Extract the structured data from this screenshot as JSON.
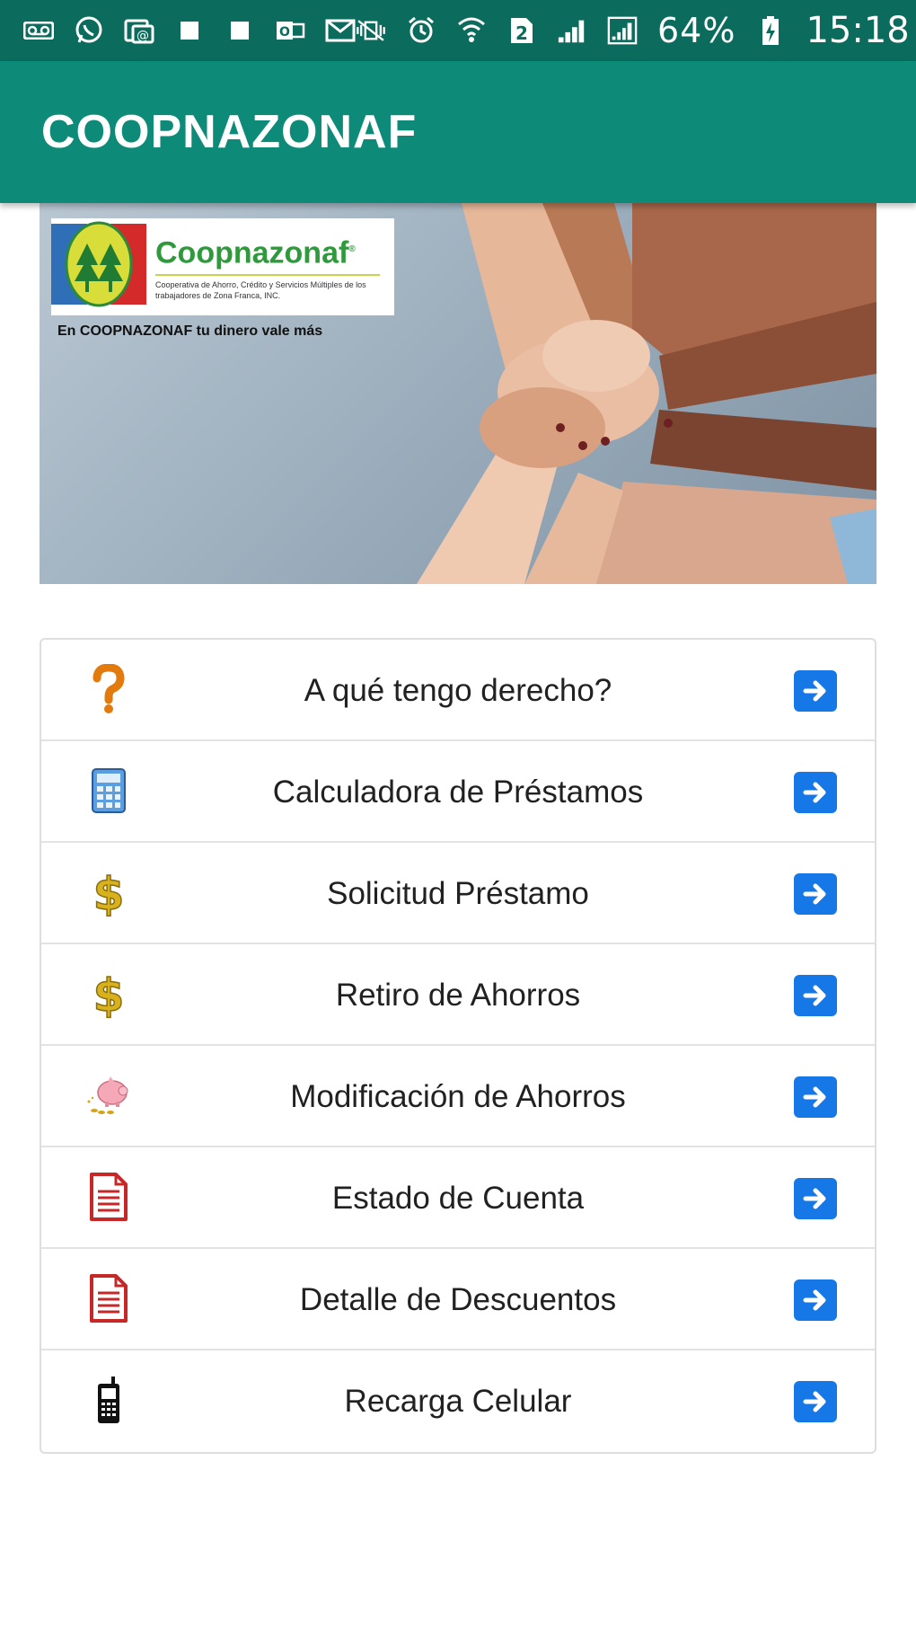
{
  "status_bar": {
    "icons_left": [
      "voicemail-icon",
      "whatsapp-icon",
      "email-app-icon",
      "square-notification-icon",
      "square-notification-icon",
      "outlook-icon",
      "mail-icon"
    ],
    "icons_right": [
      "vibrate-icon",
      "alarm-icon",
      "wifi-icon",
      "sim2-icon",
      "signal-icon",
      "signal-icon"
    ],
    "battery": "64%",
    "time": "15:18"
  },
  "app_bar": {
    "title": "COOPNAZONAF"
  },
  "banner": {
    "logo_name": "Coopnazonaf",
    "logo_mark": "®",
    "logo_subtitle": "Cooperativa de Ahorro, Crédito y Servicios Múltiples de los trabajadores de Zona Franca, INC.",
    "slogan": "En COOPNAZONAF tu dinero vale más"
  },
  "menu": {
    "items": [
      {
        "label": "A qué tengo derecho?",
        "icon": "question-mark-icon"
      },
      {
        "label": "Calculadora de Préstamos",
        "icon": "calculator-icon"
      },
      {
        "label": "Solicitud Préstamo",
        "icon": "dollar-sign-icon"
      },
      {
        "label": "Retiro de Ahorros",
        "icon": "dollar-sign-icon"
      },
      {
        "label": "Modificación de Ahorros",
        "icon": "piggy-bank-icon"
      },
      {
        "label": "Estado de Cuenta",
        "icon": "document-icon"
      },
      {
        "label": "Detalle de Descuentos",
        "icon": "document-icon"
      },
      {
        "label": "Recarga Celular",
        "icon": "mobile-phone-icon"
      }
    ],
    "arrow_icon": "arrow-right-icon"
  },
  "colors": {
    "status_bar": "#0b6b5c",
    "app_bar": "#0e8a78",
    "arrow_button": "#1677e6",
    "logo_green": "#2e9a3c"
  }
}
